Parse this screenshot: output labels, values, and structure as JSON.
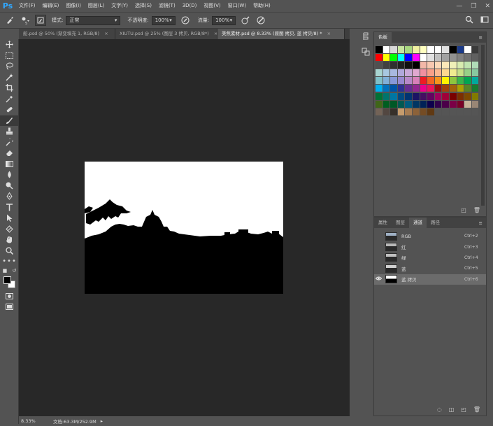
{
  "app": {
    "logo": "Ps"
  },
  "menu": [
    "文件(F)",
    "编辑(E)",
    "图像(I)",
    "图层(L)",
    "文字(Y)",
    "选择(S)",
    "滤镜(T)",
    "3D(D)",
    "视图(V)",
    "窗口(W)",
    "帮助(H)"
  ],
  "window_controls": {
    "minimize": "—",
    "restore": "❐",
    "close": "✕"
  },
  "options": {
    "mode_label": "模式:",
    "mode_value": "正常",
    "opacity_label": "不透明度:",
    "opacity_value": "100%",
    "flow_label": "流量:",
    "flow_value": "100%"
  },
  "tabs": [
    {
      "label": "船.psd @ 50% (渐变填充 1, RGB/8)",
      "close": "×"
    },
    {
      "label": "XIUTU.psd @ 25% (图层 3 拷贝, RGB/8*)",
      "close": "×"
    },
    {
      "label": "美焦素材.psd @ 8.33% (原图 拷贝, 蓝 拷贝/8) *",
      "close": "×"
    }
  ],
  "status": {
    "zoom": "8.33%",
    "doc": "文档:63.3M/252.9M"
  },
  "swatches_panel": {
    "tab": "色板"
  },
  "swatches": [
    "#000000",
    "#ffffff",
    "#d8d8d8",
    "#c8e6a0",
    "#a8d880",
    "#f0f0a0",
    "#ffffc0",
    "#ffffff",
    "#ffffff",
    "#e0e0e0",
    "#000000",
    "#1a3a8a",
    "#ffffff",
    "#3a3a3a",
    "#ff0000",
    "#ffff00",
    "#00ff00",
    "#00ffff",
    "#0000ff",
    "#ff00ff",
    "#ffffff",
    "#e0e0e0",
    "#c0c0c0",
    "#a0a0a0",
    "#909090",
    "#808080",
    "#707070",
    "#606060",
    "#505050",
    "#404040",
    "#303030",
    "#202020",
    "#101010",
    "#000000",
    "#f4b8a8",
    "#f8c8b0",
    "#fcd8b8",
    "#fce8b8",
    "#f0f0b8",
    "#d8ecb0",
    "#c0e4b0",
    "#b0dcb8",
    "#a8d4d0",
    "#a8c8e0",
    "#a8b8e0",
    "#b0a8dc",
    "#c8a8d8",
    "#e0a8d0",
    "#f090a0",
    "#f8a088",
    "#fcb890",
    "#fcd890",
    "#f0ec90",
    "#c8e088",
    "#98d088",
    "#88c8a0",
    "#80c0c8",
    "#80b0d8",
    "#8898d8",
    "#9888d0",
    "#b888c8",
    "#d880b8",
    "#ee1c24",
    "#f26522",
    "#f7941d",
    "#fff200",
    "#8dc63f",
    "#39b54a",
    "#00a651",
    "#00a99d",
    "#00aeef",
    "#0072bc",
    "#0054a6",
    "#2e3192",
    "#662d91",
    "#92278f",
    "#ec008c",
    "#ed145b",
    "#9e0b0f",
    "#a0410d",
    "#a36209",
    "#aba000",
    "#598527",
    "#197b30",
    "#007236",
    "#00746b",
    "#0076a3",
    "#004a80",
    "#003471",
    "#1b1464",
    "#440e62",
    "#630460",
    "#9e005d",
    "#9e0039",
    "#790000",
    "#7b2e00",
    "#7d4900",
    "#827b00",
    "#406618",
    "#005e20",
    "#005826",
    "#005952",
    "#005b7f",
    "#003663",
    "#002157",
    "#0d004c",
    "#32004b",
    "#4b0049",
    "#7b0046",
    "#7a0026",
    "#c7b299",
    "#998675",
    "#736357",
    "#534741",
    "#37302a",
    "#c69c6d",
    "#a67c52",
    "#8c6239",
    "#754c24",
    "#603913",
    "#555555",
    "#555555",
    "#555555",
    "#555555",
    "#555555",
    "#555555"
  ],
  "channels_panel": {
    "tabs": [
      "属性",
      "图层",
      "通道",
      "路径"
    ],
    "rows": [
      {
        "name": "RGB",
        "key": "Ctrl+2"
      },
      {
        "name": "红",
        "key": "Ctrl+3"
      },
      {
        "name": "绿",
        "key": "Ctrl+4"
      },
      {
        "name": "蓝",
        "key": "Ctrl+5"
      },
      {
        "name": "蓝 拷贝",
        "key": "Ctrl+6",
        "selected": true
      }
    ]
  },
  "colors": {
    "accent": "#31a8ff",
    "canvas_bg": "#282828",
    "ui_bg": "#535353"
  }
}
